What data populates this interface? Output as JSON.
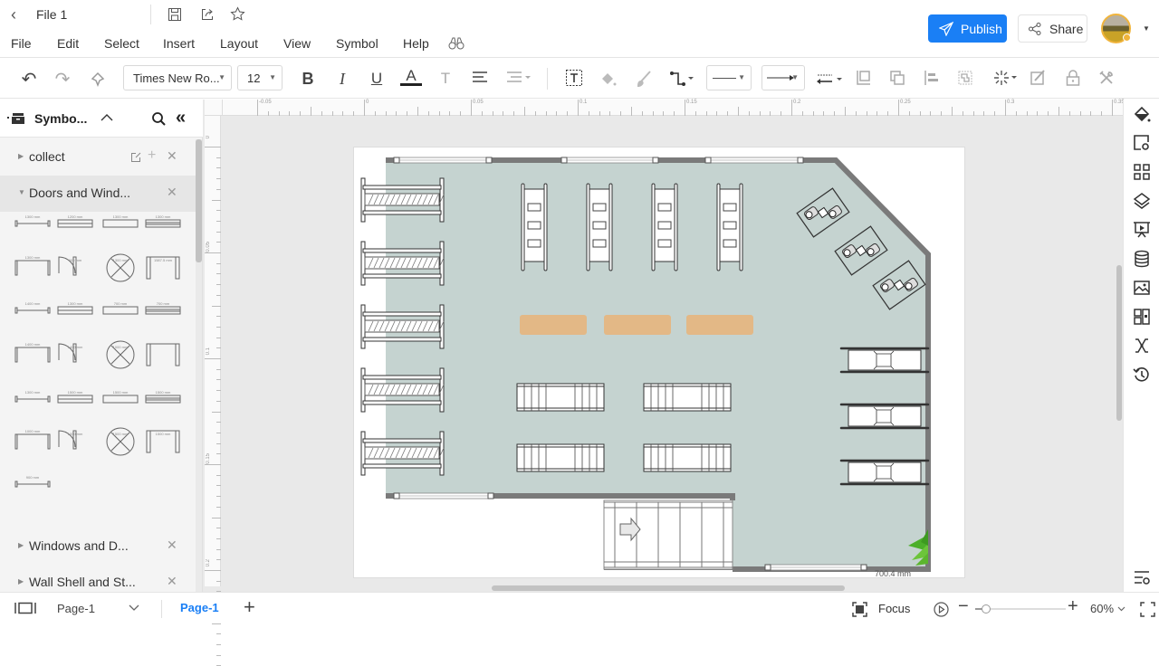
{
  "title_bar": {
    "file_name": "File 1",
    "publish_label": "Publish",
    "share_label": "Share"
  },
  "menu": {
    "items": [
      "File",
      "Edit",
      "Select",
      "Insert",
      "Layout",
      "View",
      "Symbol",
      "Help"
    ]
  },
  "toolbar": {
    "font_family": "Times New Ro...",
    "font_size": "12"
  },
  "sidebar": {
    "title": "Symbo...",
    "libraries": [
      {
        "label": "collect",
        "expanded": false
      },
      {
        "label": "Doors and Wind...",
        "expanded": true
      },
      {
        "label": "Windows and D...",
        "expanded": false
      },
      {
        "label": "Wall Shell and St...",
        "expanded": false
      }
    ],
    "symbols": [
      {
        "name": "single-door",
        "caption": "1300 mm"
      },
      {
        "name": "window-double",
        "caption": "1200 mm"
      },
      {
        "name": "window-single",
        "caption": "1300 mm"
      },
      {
        "name": "window-triple",
        "caption": "1300 mm"
      },
      {
        "name": "opening",
        "caption": "1300 mm"
      },
      {
        "name": "sliding-door",
        "caption": "900 mm"
      },
      {
        "name": "pocket-door",
        "caption": "1300 mm"
      },
      {
        "name": "frame-door",
        "caption": "1587.5 mm"
      },
      {
        "name": "bifold-door",
        "caption": "1400 mm"
      },
      {
        "name": "open-wall",
        "caption": "1300 mm"
      },
      {
        "name": "swing-door",
        "caption": "700 mm"
      },
      {
        "name": "half-round-door",
        "caption": "700 mm"
      },
      {
        "name": "double-swing-door",
        "caption": "1400 mm"
      },
      {
        "name": "unequal-double-door",
        "caption": "1400 mm"
      },
      {
        "name": "offset-door",
        "caption": "1000 mm"
      },
      {
        "name": "revolving-door",
        "caption": ""
      },
      {
        "name": "curtain-door",
        "caption": "1300 mm"
      },
      {
        "name": "slide-window",
        "caption": "1500 mm"
      },
      {
        "name": "double-slide",
        "caption": "1500 mm"
      },
      {
        "name": "sliding-panel",
        "caption": "1500 mm"
      },
      {
        "name": "folding-door",
        "caption": "1000 mm"
      },
      {
        "name": "double-folding",
        "caption": "1000 mm"
      },
      {
        "name": "bypass-door",
        "caption": "1500 mm"
      },
      {
        "name": "garage-door",
        "caption": "1500 mm"
      },
      {
        "name": "accordion-door",
        "caption": "900 mm"
      }
    ]
  },
  "ruler": {
    "h_ticks": [
      "-0.05",
      "0",
      "0.05",
      "0.1",
      "0.15",
      "0.2",
      "0.25",
      "0.3",
      "0.35"
    ],
    "v_ticks": [
      "0",
      "0.05",
      "0.1",
      "0.15",
      "0.2"
    ]
  },
  "canvas": {
    "floor_color": "#c5d3d0",
    "wall_color": "#7a7a7a",
    "table_color": "#e3b886",
    "dimension_text": "700.4 mm"
  },
  "status_bar": {
    "page_selector": "Page-1",
    "active_page_tab": "Page-1",
    "focus_label": "Focus",
    "zoom_value": "60%",
    "zoom_fraction": 0.12
  },
  "colors": {
    "accent": "#1a7ff5"
  }
}
